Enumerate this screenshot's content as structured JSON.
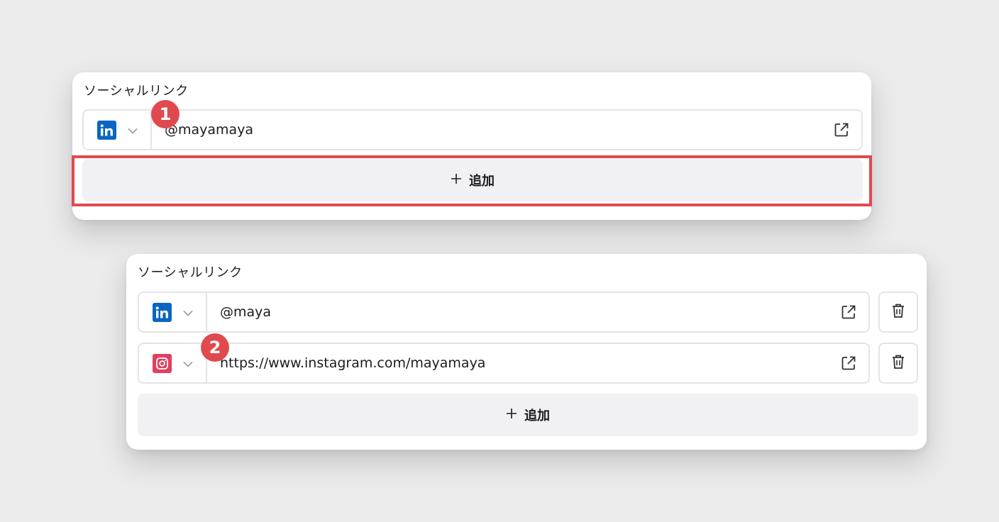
{
  "colors": {
    "page_background": "#ebebec",
    "highlight": "#e04a4f",
    "linkedin_brand": "#0a66c2",
    "instagram_brand": "#e0405e"
  },
  "card_top": {
    "title": "ソーシャルリンク",
    "links": [
      {
        "service_icon": "linkedin-icon",
        "value": "@mayamaya"
      }
    ],
    "add_label": "追加"
  },
  "card_bottom": {
    "title": "ソーシャルリンク",
    "links": [
      {
        "service_icon": "linkedin-icon",
        "value": "@maya"
      },
      {
        "service_icon": "instagram-icon",
        "value": "https://www.instagram.com/mayamaya"
      }
    ],
    "add_label": "追加"
  },
  "annotations": {
    "step_1": "1",
    "step_2": "2"
  }
}
